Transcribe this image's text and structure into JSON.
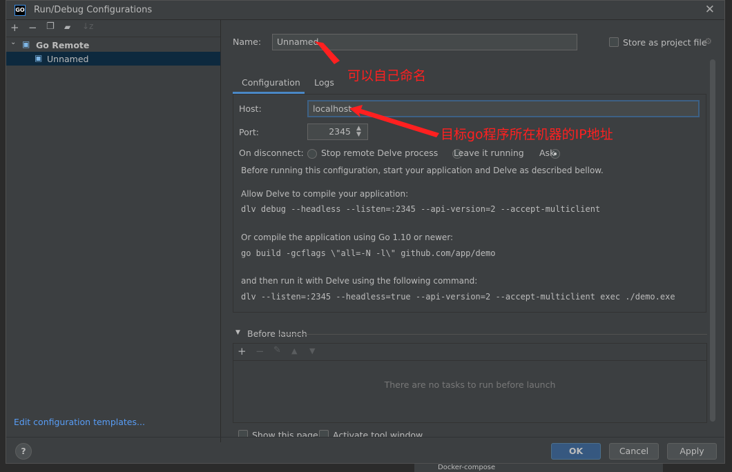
{
  "window": {
    "title": "Run/Debug Configurations",
    "logo": "GO"
  },
  "toolbar": {
    "icons": [
      "plus-icon",
      "minus-icon",
      "copy-icon",
      "folder-add-icon",
      "sort-icon"
    ]
  },
  "tree": {
    "group": "Go Remote",
    "item": "Unnamed"
  },
  "edit_templates": "Edit configuration templates...",
  "name": {
    "label": "Name:",
    "value": "Unnamed"
  },
  "store": {
    "label": "Store as project file",
    "checked": false
  },
  "tabs": [
    {
      "label": "Configuration",
      "active": true
    },
    {
      "label": "Logs",
      "active": false
    }
  ],
  "host": {
    "label": "Host:",
    "value": "localhost"
  },
  "port": {
    "label": "Port:",
    "value": "2345"
  },
  "disconnect": {
    "label": "On disconnect:",
    "options": [
      "Stop remote Delve process",
      "Leave it running",
      "Ask"
    ],
    "selected": "Ask"
  },
  "info": {
    "intro": "Before running this configuration, start your application and Delve as described bellow.",
    "p1": "Allow Delve to compile your application:",
    "c1": "dlv debug --headless --listen=:2345 --api-version=2 --accept-multiclient",
    "p2": "Or compile the application using Go 1.10 or newer:",
    "c2": "go build -gcflags \\\"all=-N -l\\\" github.com/app/demo",
    "p3": "and then run it with Delve using the following command:",
    "c3": "dlv --listen=:2345 --headless=true --api-version=2 --accept-multiclient exec ./demo.exe"
  },
  "before_launch": {
    "label": "Before launch",
    "empty": "There are no tasks to run before launch"
  },
  "bottom_checks": {
    "show_page": "Show this page",
    "activate": "Activate tool window"
  },
  "buttons": {
    "ok": "OK",
    "cancel": "Cancel",
    "apply": "Apply",
    "help": "?"
  },
  "annotations": {
    "name_note": "可以自己命名",
    "host_note": "目标go程序所在机器的IP地址",
    "color": "#ff2020"
  },
  "background": {
    "docker": "Docker-compose"
  }
}
